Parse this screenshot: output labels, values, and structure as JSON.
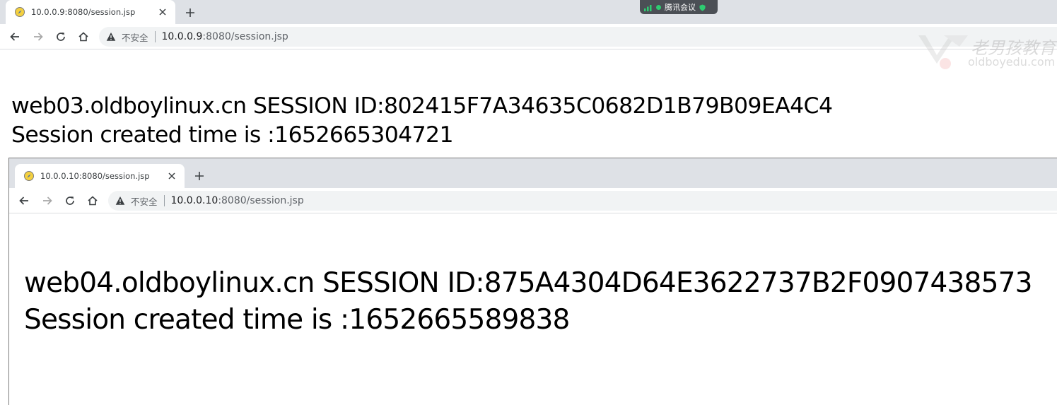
{
  "window1": {
    "tab_title": "10.0.0.9:8080/session.jsp",
    "insecure_label": "不安全",
    "url_host": "10.0.0.9",
    "url_rest": ":8080/session.jsp",
    "lines": [
      "web03.oldboylinux.cn SESSION ID:802415F7A34635C0682D1B79B09EA4C4",
      "Session created time is :1652665304721"
    ]
  },
  "window2": {
    "tab_title": "10.0.0.10:8080/session.jsp",
    "insecure_label": "不安全",
    "url_host": "10.0.0.10",
    "url_rest": ":8080/session.jsp",
    "lines": [
      "web04.oldboylinux.cn SESSION ID:875A4304D64E3622737B2F0907438573",
      "Session created time is :1652665589838"
    ]
  },
  "meeting_badge": {
    "label": "腾讯会议"
  },
  "watermark": {
    "text_cn": "老男孩教育",
    "text_en": "oldboyedu.com"
  },
  "icons": {
    "favicon": "compass-icon",
    "close": "close-icon",
    "new_tab": "plus-icon",
    "back": "back-arrow-icon",
    "forward": "forward-arrow-icon",
    "reload": "reload-icon",
    "home": "home-icon",
    "insecure": "warning-triangle-icon"
  },
  "colors": {
    "tabstrip": "#dee1e6",
    "omnibox": "#f1f3f4",
    "meeting_badge": "#4b4f55",
    "meeting_dot": "#2ecc71"
  }
}
